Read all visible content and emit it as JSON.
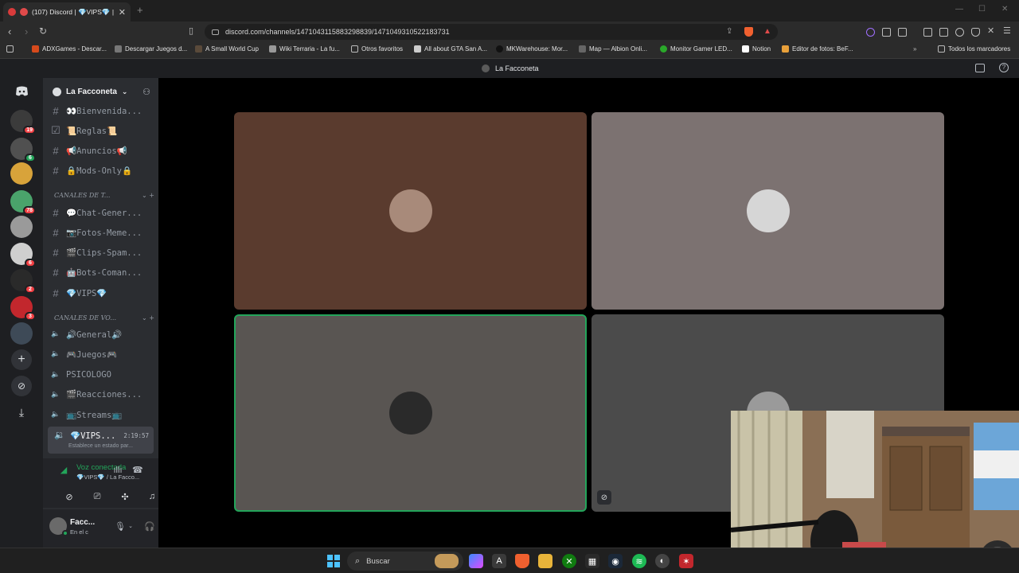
{
  "browser": {
    "tab_title": "(107) Discord | 💎VIPS💎 | L",
    "url": "discord.com/channels/1471043115883298839/1471049310522183731",
    "bookmarks": [
      "ADXGames - Descar...",
      "Descargar Juegos d...",
      "A Small World Cup",
      "Wiki Terraria - La fu...",
      "Otros favoritos",
      "All about GTA San A...",
      "MKWarehouse: Mor...",
      "Map — Albion Onli...",
      "Monitor Gamer LED...",
      "Notion",
      "Editor de fotos: BeF...",
      "Todos los marcadores"
    ]
  },
  "discord": {
    "window_title": "La Facconeta",
    "guilds": [
      {
        "badge": "19",
        "color": "#3b3b3b"
      },
      {
        "badge": "6",
        "badge_color": "green",
        "color": "#505050"
      },
      {
        "badge": "",
        "color": "#d8a33a"
      },
      {
        "badge": "78",
        "color": "#4aa36b"
      },
      {
        "badge": "",
        "color": "#9a9a9a"
      },
      {
        "badge": "6",
        "color": "#cfcfcf"
      },
      {
        "badge": "2",
        "color": "#2a2a2a"
      },
      {
        "badge": "3",
        "color": "#c2272d"
      },
      {
        "badge": "",
        "color": "#3e4a57"
      }
    ],
    "server_name": "La Facconeta",
    "text_channels": [
      {
        "icon": "hash",
        "name": "👀Bienvenida..."
      },
      {
        "icon": "rules",
        "name": "📜Reglas📜"
      },
      {
        "icon": "hash",
        "name": "📢Anuncios📢"
      },
      {
        "icon": "hash",
        "name": "🔒Mods-Only🔒"
      }
    ],
    "category_text": "CANALES DE T...",
    "text_channels_2": [
      {
        "icon": "hash",
        "name": "💬Chat-Gener..."
      },
      {
        "icon": "hash",
        "name": "📷Fotos-Meme..."
      },
      {
        "icon": "hash",
        "name": "🎬Clips-Spam..."
      },
      {
        "icon": "hash",
        "name": "🤖Bots-Coman..."
      },
      {
        "icon": "hash",
        "name": "💎VIPS💎"
      }
    ],
    "category_voice": "CANALES DE VO...",
    "voice_channels": [
      {
        "name": "🔊General🔊"
      },
      {
        "name": "🎮Juegos🎮"
      },
      {
        "name": "PSICOLOGO"
      },
      {
        "name": "🎬Reacciones..."
      },
      {
        "name": "📺Streams📺"
      }
    ],
    "active_channel": {
      "name": "💎VIPS...",
      "time": "2:19:57",
      "status_placeholder": "Establece un estado par..."
    },
    "voice_panel": {
      "status": "Voz conectada",
      "location": "💎VIPS💎 / La Facco..."
    },
    "user": {
      "name": "Facc...",
      "status": "En el c"
    },
    "tiles": [
      {
        "bg": "#5a3b2e",
        "avatar": "#a88a7a",
        "speaking": false
      },
      {
        "bg": "#7c7271",
        "avatar": "#d6d6d6",
        "speaking": false
      },
      {
        "bg": "#595552",
        "avatar": "#2a2a2a",
        "speaking": true
      },
      {
        "bg": "#4b4b4b",
        "avatar": "#9a9a9a",
        "speaking": false
      }
    ]
  },
  "taskbar": {
    "search_label": "Buscar"
  },
  "colors": {
    "accent_green": "#23a55a",
    "badge_red": "#f23f43"
  }
}
